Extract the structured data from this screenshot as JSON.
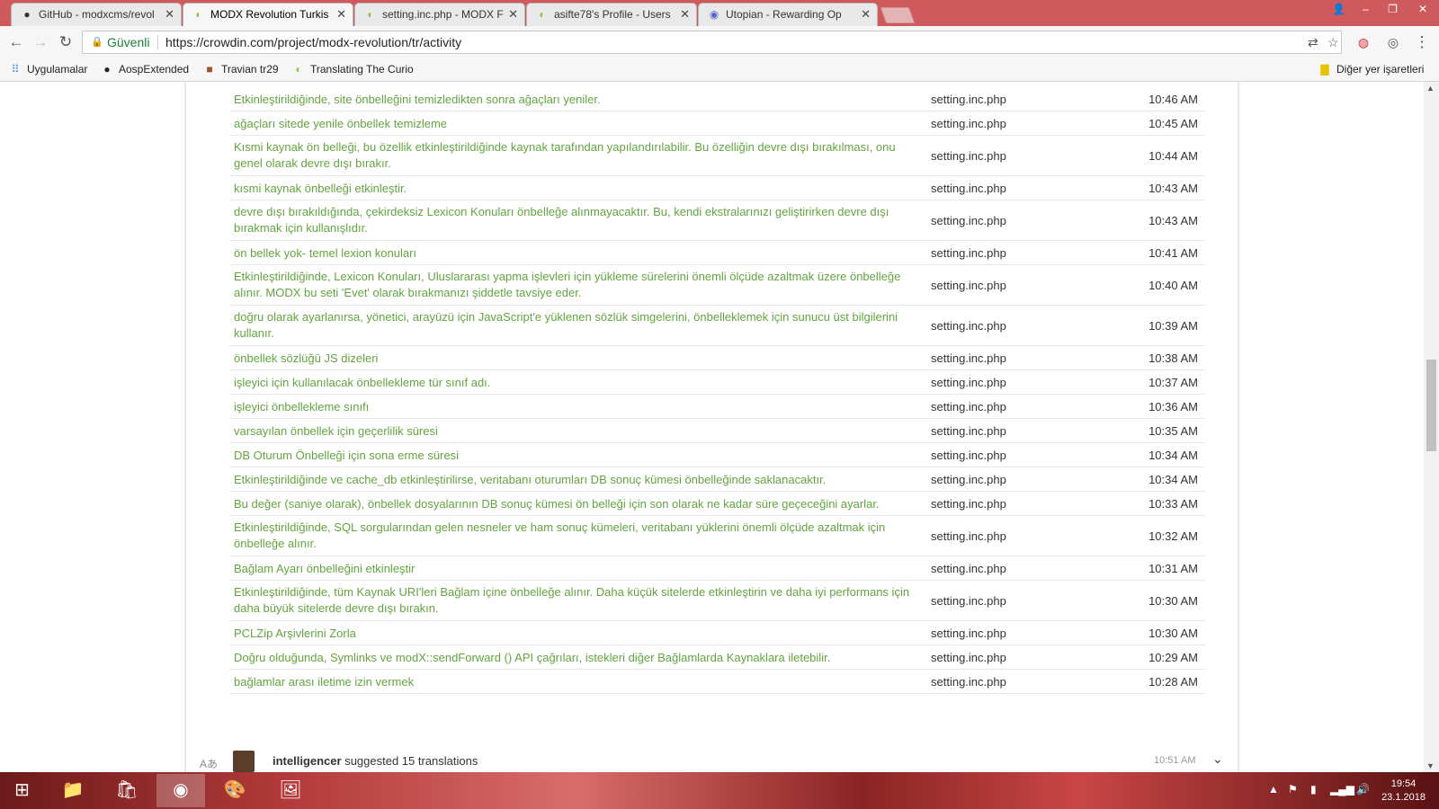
{
  "tabs": [
    {
      "title": "GitHub - modxcms/revol",
      "icon": "github-icon"
    },
    {
      "title": "MODX Revolution Turkis",
      "icon": "crowdin-icon"
    },
    {
      "title": "setting.inc.php - MODX F",
      "icon": "crowdin-icon"
    },
    {
      "title": "asifte78's Profile - Users",
      "icon": "crowdin-icon"
    },
    {
      "title": "Utopian - Rewarding Op",
      "icon": "utopian-icon"
    }
  ],
  "active_tab_index": 1,
  "address_bar": {
    "secure_label": "Güvenli",
    "url": "https://crowdin.com/project/modx-revolution/tr/activity"
  },
  "bookmarks": {
    "apps": "Uygulamalar",
    "items": [
      "AospExtended",
      "Travian tr29",
      "Translating The Curio"
    ],
    "other": "Diğer yer işaretleri"
  },
  "activity_rows": [
    {
      "message": "Etkinleştirildiğinde, site önbelleğini temizledikten sonra ağaçları yeniler.",
      "file": "setting.inc.php",
      "time": "10:46 AM"
    },
    {
      "message": "ağaçları sitede yenile önbellek temizleme",
      "file": "setting.inc.php",
      "time": "10:45 AM"
    },
    {
      "message": "Kısmi kaynak ön belleği, bu özellik etkinleştirildiğinde kaynak tarafından yapılandırılabilir. Bu özelliğin devre dışı bırakılması, onu genel olarak devre dışı bırakır.",
      "file": "setting.inc.php",
      "time": "10:44 AM"
    },
    {
      "message": "kısmi kaynak önbelleği etkinleştir.",
      "file": "setting.inc.php",
      "time": "10:43 AM"
    },
    {
      "message": "devre dışı bırakıldığında, çekirdeksiz Lexicon Konuları önbelleğe alınmayacaktır. Bu, kendi ekstralarınızı geliştirirken devre dışı bırakmak için kullanışlıdır.",
      "file": "setting.inc.php",
      "time": "10:43 AM"
    },
    {
      "message": "ön bellek yok- temel lexion konuları",
      "file": "setting.inc.php",
      "time": "10:41 AM"
    },
    {
      "message": "Etkinleştirildiğinde, Lexicon Konuları, Uluslararası yapma işlevleri için yükleme sürelerini önemli ölçüde azaltmak üzere önbelleğe alınır. MODX bu seti 'Evet' olarak bırakmanızı şiddetle tavsiye eder.",
      "file": "setting.inc.php",
      "time": "10:40 AM"
    },
    {
      "message": "doğru olarak ayarlanırsa, yönetici, arayüzü için JavaScript'e yüklenen sözlük simgelerini, önbelleklemek için sunucu üst bilgilerini kullanır.",
      "file": "setting.inc.php",
      "time": "10:39 AM"
    },
    {
      "message": "önbellek sözlüğü JS dizeleri",
      "file": "setting.inc.php",
      "time": "10:38 AM"
    },
    {
      "message": "işleyici için kullanılacak önbellekleme tür sınıf adı.",
      "file": "setting.inc.php",
      "time": "10:37 AM"
    },
    {
      "message": "işleyici önbellekleme sınıfı",
      "file": "setting.inc.php",
      "time": "10:36 AM"
    },
    {
      "message": "varsayılan önbellek için geçerlilik süresi",
      "file": "setting.inc.php",
      "time": "10:35 AM"
    },
    {
      "message": "DB Oturum Önbelleği için sona erme süresi",
      "file": "setting.inc.php",
      "time": "10:34 AM"
    },
    {
      "message": "Etkinleştirildiğinde ve cache_db etkinleştirilirse, veritabanı oturumları DB sonuç kümesi önbelleğinde saklanacaktır.",
      "file": "setting.inc.php",
      "time": "10:34 AM"
    },
    {
      "message": "Bu değer (saniye olarak), önbellek dosyalarının DB sonuç kümesi ön belleği için son olarak ne kadar süre geçeceğini ayarlar.",
      "file": "setting.inc.php",
      "time": "10:33 AM"
    },
    {
      "message": "Etkinleştirildiğinde, SQL sorgularından gelen nesneler ve ham sonuç kümeleri, veritabanı yüklerini önemli ölçüde azaltmak için önbelleğe alınır.",
      "file": "setting.inc.php",
      "time": "10:32 AM"
    },
    {
      "message": "Bağlam Ayarı önbelleğini etkinleştir",
      "file": "setting.inc.php",
      "time": "10:31 AM"
    },
    {
      "message": "Etkinleştirildiğinde, tüm Kaynak URI'leri Bağlam içine önbelleğe alınır. Daha küçük sitelerde etkinleştirin ve daha iyi performans için daha büyük sitelerde devre dışı bırakın.",
      "file": "setting.inc.php",
      "time": "10:30 AM"
    },
    {
      "message": "PCLZip Arşivlerini Zorla",
      "file": "setting.inc.php",
      "time": "10:30 AM"
    },
    {
      "message": "Doğru olduğunda, Symlinks ve modX::sendForward () API çağrıları, istekleri diğer Bağlamlarda Kaynaklara iletebilir.",
      "file": "setting.inc.php",
      "time": "10:29 AM"
    },
    {
      "message": "bağlamlar arası iletime izin vermek",
      "file": "setting.inc.php",
      "time": "10:28 AM"
    }
  ],
  "next_entry": {
    "user": "intelligencer",
    "action": "suggested 15 translations",
    "time": "10:51 AM"
  },
  "taskbar": {
    "clock_time": "19:54",
    "clock_date": "23.1.2018"
  },
  "colors": {
    "tabstrip": "#cf5a5e",
    "link_green": "#63a440",
    "secure_green": "#188038"
  }
}
